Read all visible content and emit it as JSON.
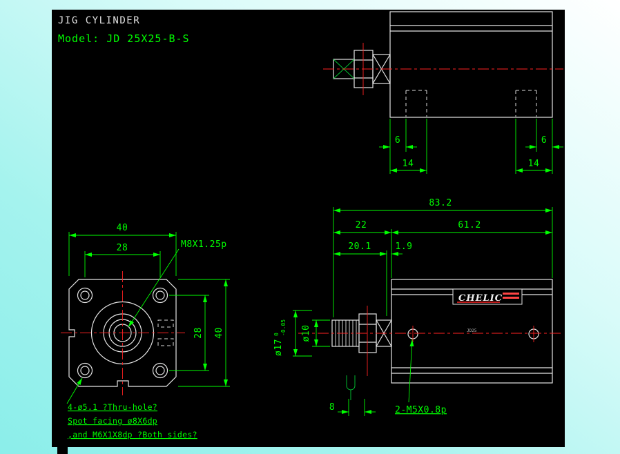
{
  "colors": {
    "canvas": "#000000",
    "geometry": "#e6e6e6",
    "dimension": "#00ff00",
    "centerline": "#ff2222",
    "desktop": "#8beeea"
  },
  "title": {
    "product": "JIG CYLINDER",
    "model": "Model:  JD 25X25-B-S"
  },
  "top_view": {
    "dim_edge_left": "6",
    "dim_hole_left": "14",
    "dim_edge_right": "6",
    "dim_hole_right": "14"
  },
  "front_view": {
    "dim_outer_width": "40",
    "dim_hole_pitch_h": "28",
    "dim_hole_pitch_v": "28",
    "dim_outer_height": "40",
    "thread_label": "M8X1.25p",
    "note_line1": "4-ø5.1 ?Thru-hole?",
    "note_line2": "Spot facing  ø8X6dp",
    "note_line3": ",and M6X1X8dp ?Both sides?"
  },
  "side_view": {
    "dim_overall": "83.2",
    "dim_rod_section": "22",
    "dim_body_length": "61.2",
    "dim_rod_length": "20.1",
    "dim_spacer": "1.9",
    "dim_boss_dia": "ø17",
    "boss_tol_upper": "0",
    "boss_tol_lower": "-0.05",
    "dim_rod_dia": "ø10",
    "dim_wrench_flat": "8",
    "port_label": "2-M5X0.8p",
    "logo_text": "CHELIC",
    "body_stamp": "JD25"
  }
}
